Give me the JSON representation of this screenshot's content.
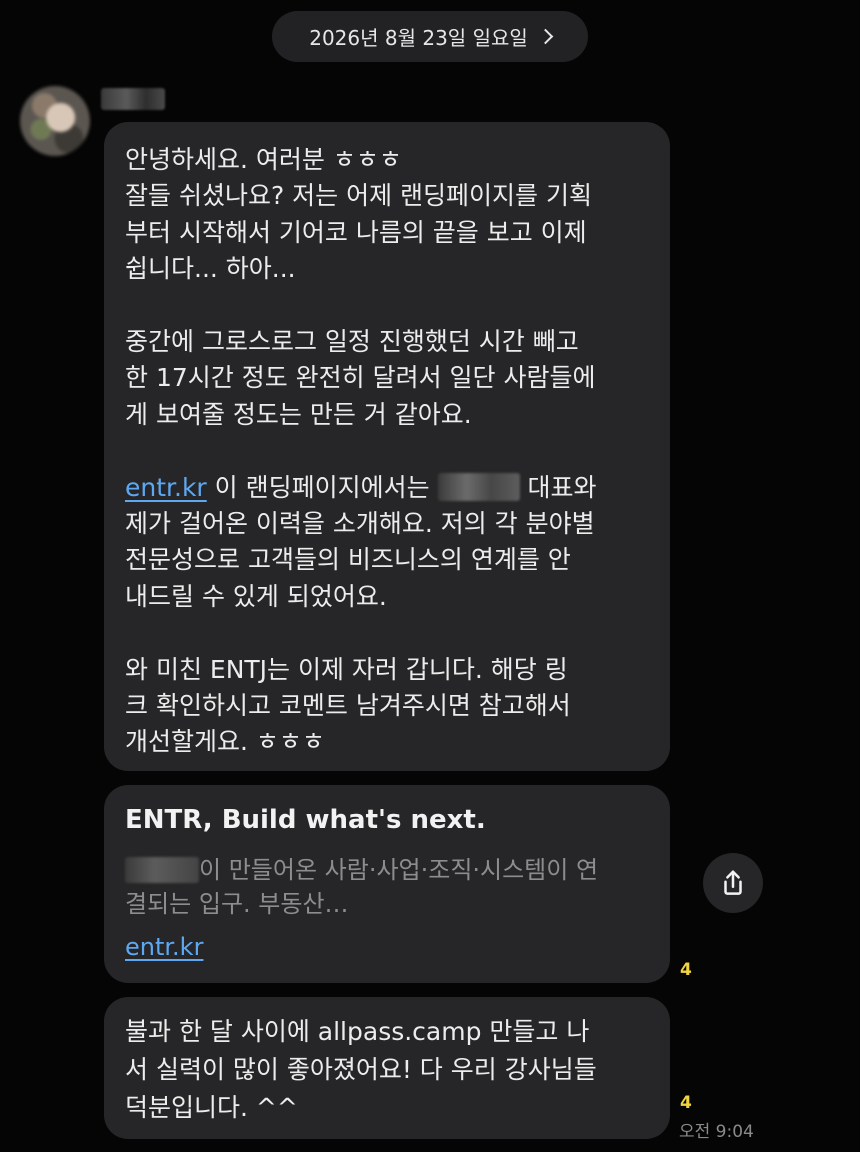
{
  "date_header": {
    "label": "2026년 8월 23일 일요일"
  },
  "message1": {
    "lines": [
      "안녕하세요. 여러분 ㅎㅎㅎ",
      "잘들 쉬셨나요? 저는 어제 랜딩페이지를 기획",
      "부터 시작해서 기어코 나름의 끝을 보고 이제",
      "쉽니다... 하아...",
      "중간에 그로스로그 일정 진행했던 시간 빼고",
      "한 17시간 정도 완전히 달려서 일단 사람들에",
      "게 보여줄 정도는 만든 거 같아요."
    ],
    "link_text": "entr.kr",
    "after_link": "이 랜딩페이지에서는",
    "after_blur": "대표와",
    "lines2": [
      "제가 걸어온 이력을 소개해요. 저의 각 분야별",
      "전문성으로 고객들의 비즈니스의 연계를 안",
      "내드릴 수 있게 되었어요."
    ],
    "lines3": [
      "와 미친 ENTJ는 이제 자러 갑니다. 해당 링",
      "크 확인하시고 코멘트 남겨주시면 참고해서",
      "개선할게요. ㅎㅎㅎ"
    ]
  },
  "link_preview": {
    "title": "ENTR, Build what's next.",
    "desc_line1": "이 만들어온 사람·사업·조직·시스템이 연",
    "desc_line2": "결되는 입구. 부동산…",
    "url": "entr.kr",
    "unread_count": "4",
    "share_icon": "share-icon"
  },
  "message2": {
    "lines": [
      "불과 한 달 사이에 allpass.camp 만들고 나",
      "서 실력이 많이 좋아졌어요! 다 우리 강사님들",
      "덕분입니다. ^^"
    ],
    "unread_count": "4",
    "time": "오전 9:04"
  }
}
